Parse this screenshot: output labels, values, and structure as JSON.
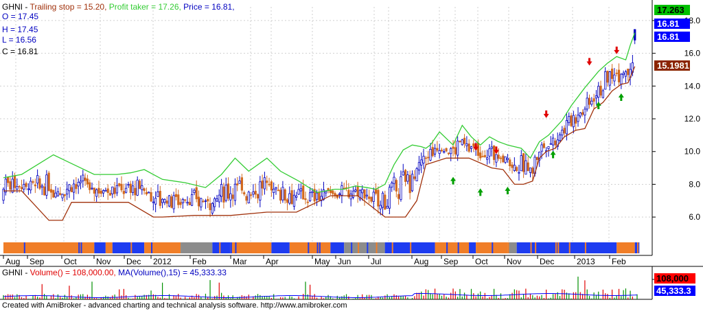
{
  "header": {
    "ticker": "GHNI",
    "trailing_label": "Trailing stop = 15.20,",
    "profit_label": "Profit taker = 17.26,",
    "price_label": "Price = 16.81,",
    "open": "O = 17.45",
    "high": "H = 17.45",
    "low": "L = 16.56",
    "close": "C = 16.81"
  },
  "price_tags": [
    {
      "text": "17.263",
      "color": "#00c000",
      "fg": "#000000"
    },
    {
      "text": "16.81",
      "color": "#0000ff",
      "fg": "#ffffff"
    },
    {
      "text": "16.81",
      "color": "#0000ff",
      "fg": "#ffffff"
    },
    {
      "text": "15.1981",
      "color": "#8b2500",
      "fg": "#ffffff"
    }
  ],
  "volume_header": {
    "text_prefix": "GHNI - ",
    "vol_label": "Volume() = 108,000.00,",
    "ma_label": "MA(Volume(),15) = 45,333.33"
  },
  "volume_tags": [
    {
      "text": "108,000",
      "color": "#ff0000",
      "fg": "#000000"
    },
    {
      "text": "45,333.3",
      "color": "#0000ff",
      "fg": "#ffffff"
    }
  ],
  "footer": "Created with AmiBroker - advanced charting and technical analysis software. http://www.amibroker.com",
  "colors": {
    "up": "#0000c0",
    "down": "#d2691e",
    "trailing": "#a0300a",
    "profit": "#33cc33",
    "grid": "#cfcfcf",
    "band_blue": "#1e3cf0",
    "band_orange": "#f07e28",
    "band_gray": "#8c8c8c",
    "buy": "#00a000",
    "sell": "#e00000"
  },
  "chart_data": {
    "type": "candlestick",
    "title": "GHNI",
    "y_ticks": [
      "6.0",
      "8.0",
      "10.0",
      "12.0",
      "14.0",
      "16.0",
      "18.0"
    ],
    "ylim": [
      5.0,
      18.5
    ],
    "x_ticks": [
      "Aug",
      "Sep",
      "Oct",
      "Nov",
      "Dec",
      "2012",
      "Feb",
      "Mar",
      "Apr",
      "May",
      "Jun",
      "Jul",
      "Aug",
      "Sep",
      "Oct",
      "Nov",
      "Dec",
      "2013",
      "Feb"
    ],
    "series": [
      {
        "name": "Trailing stop",
        "x": [
          0,
          8,
          20,
          26,
          30,
          34,
          55,
          66,
          70,
          84,
          100,
          116,
          129,
          144,
          156,
          168,
          177,
          182,
          186,
          195,
          205,
          215,
          220,
          225,
          229,
          233,
          236,
          239,
          243,
          247,
          252,
          256,
          260,
          264,
          268,
          272,
          275,
          278
        ],
        "y": [
          7.6,
          7.6,
          5.8,
          5.8,
          6.9,
          6.9,
          6.9,
          6.0,
          6.0,
          6.1,
          6.1,
          6.3,
          6.3,
          7.3,
          7.3,
          6.0,
          6.0,
          7.0,
          9.2,
          9.6,
          9.6,
          9.0,
          8.9,
          8.0,
          8.0,
          8.2,
          9.6,
          10.0,
          10.2,
          10.9,
          11.3,
          11.4,
          12.6,
          13.0,
          13.7,
          14.1,
          14.2,
          15.2
        ]
      },
      {
        "name": "Profit taker",
        "x": [
          0,
          8,
          22,
          28,
          34,
          40,
          50,
          56,
          62,
          70,
          80,
          89,
          96,
          102,
          108,
          116,
          122,
          130,
          138,
          142,
          146,
          150,
          155,
          160,
          164,
          168,
          172,
          176,
          180,
          184,
          186,
          188,
          192,
          198,
          202,
          206,
          210,
          214,
          218,
          220,
          222,
          228,
          232,
          236,
          240,
          246,
          250,
          256,
          262,
          266,
          270,
          274,
          276,
          278
        ],
        "y": [
          8.4,
          8.6,
          9.8,
          9.4,
          9.0,
          8.6,
          8.6,
          8.7,
          8.9,
          8.3,
          8.1,
          7.8,
          8.6,
          9.6,
          8.8,
          9.6,
          8.8,
          8.2,
          7.5,
          7.6,
          7.7,
          7.7,
          7.9,
          7.8,
          7.7,
          8.0,
          9.2,
          10.1,
          10.4,
          10.3,
          10.2,
          10.4,
          11.2,
          10.4,
          11.6,
          10.9,
          10.4,
          10.9,
          10.6,
          10.5,
          10.4,
          10.2,
          9.6,
          10.6,
          11.0,
          11.9,
          12.8,
          13.9,
          14.9,
          15.4,
          15.8,
          15.6,
          16.5,
          17.26
        ]
      }
    ],
    "buy_signals": [
      {
        "x": 198,
        "y": 8.2
      },
      {
        "x": 210,
        "y": 7.5
      },
      {
        "x": 222,
        "y": 7.6
      },
      {
        "x": 242,
        "y": 9.8
      },
      {
        "x": 262,
        "y": 12.8
      },
      {
        "x": 272,
        "y": 13.3
      }
    ],
    "sell_signals": [
      {
        "x": 208,
        "y": 10.3
      },
      {
        "x": 217,
        "y": 10.1
      },
      {
        "x": 239,
        "y": 12.3
      },
      {
        "x": 258,
        "y": 15.5
      },
      {
        "x": 270,
        "y": 16.2
      }
    ],
    "last": {
      "open": 17.45,
      "high": 17.45,
      "low": 16.56,
      "close": 16.81
    }
  },
  "volume_data": {
    "last_volume": 108000,
    "ma15": 45333.33
  }
}
